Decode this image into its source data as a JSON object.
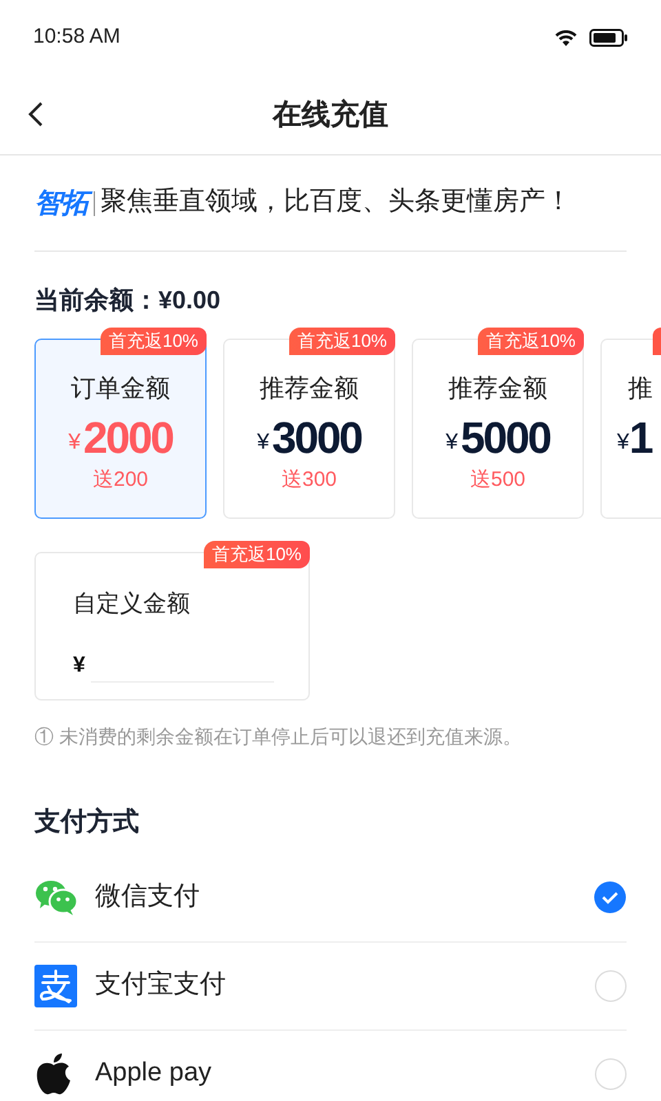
{
  "status_bar": {
    "time": "10:58 AM"
  },
  "nav": {
    "title": "在线充值"
  },
  "banner": {
    "logo": "智拓",
    "slogan": "聚焦垂直领域，比百度、头条更懂房产！"
  },
  "balance": "当前余额：¥0.00",
  "packages": [
    {
      "label": "订单金额",
      "currency": "¥",
      "amount": "2000",
      "bonus": "送200",
      "badge": "首充返10%",
      "selected": true
    },
    {
      "label": "推荐金额",
      "currency": "¥",
      "amount": "3000",
      "bonus": "送300",
      "badge": "首充返10%",
      "selected": false
    },
    {
      "label": "推荐金额",
      "currency": "¥",
      "amount": "5000",
      "bonus": "送500",
      "badge": "首充返10%",
      "selected": false
    },
    {
      "kind": "partial",
      "label": "推",
      "currency": "¥",
      "amount": "1",
      "selected": false
    }
  ],
  "custom_amount": {
    "label": "自定义金额",
    "currency": "¥",
    "badge": "首充返10%"
  },
  "note": "① 未消费的剩余金额在订单停止后可以退还到充值来源。",
  "payment": {
    "title": "支付方式",
    "methods": [
      {
        "kind": "wechat",
        "label": "微信支付",
        "selected": true
      },
      {
        "kind": "alipay",
        "label": "支付宝支付",
        "selected": false
      },
      {
        "kind": "apple",
        "label": "Apple pay",
        "selected": false
      }
    ]
  }
}
